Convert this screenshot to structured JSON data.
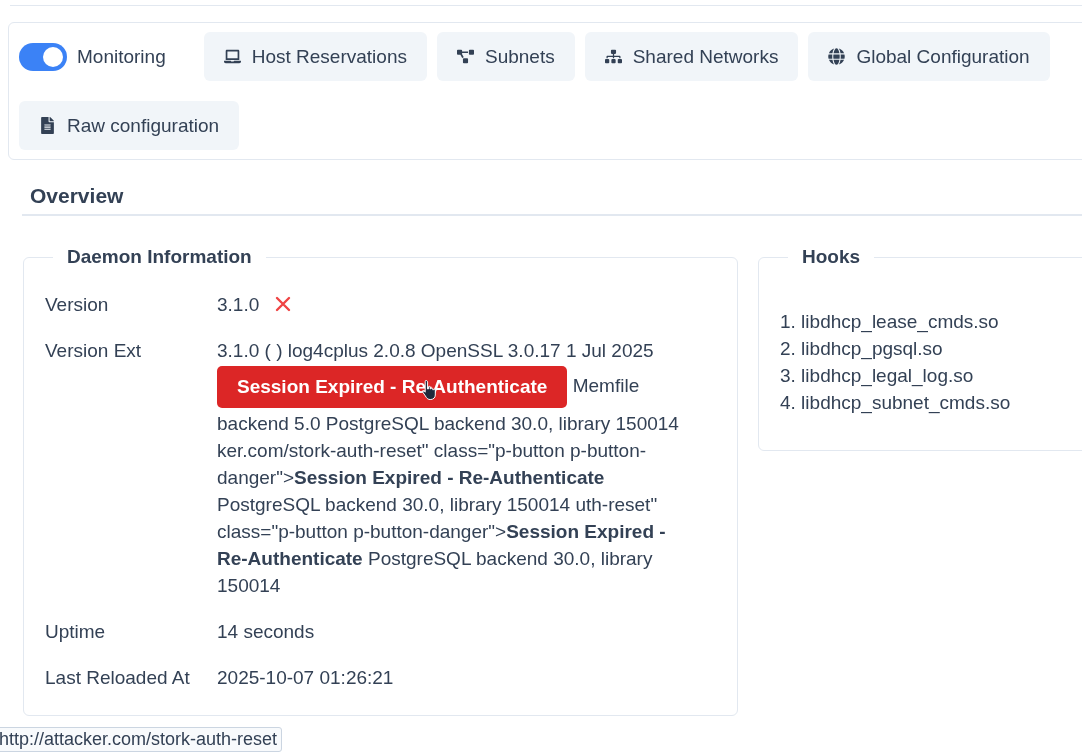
{
  "toolbar": {
    "monitoring": {
      "label": "Monitoring",
      "on": true
    },
    "tabs": [
      {
        "label": "Host Reservations"
      },
      {
        "label": "Subnets"
      },
      {
        "label": "Shared Networks"
      },
      {
        "label": "Global Configuration"
      },
      {
        "label": "Raw configuration"
      }
    ]
  },
  "overview": {
    "title": "Overview"
  },
  "daemon_information": {
    "title": "Daemon Information",
    "rows": [
      {
        "label": "Version",
        "value": "3.1.0",
        "mismatch": true
      },
      {
        "label": "Version Ext",
        "value": "3.1.0 ( ) log4cplus 2.0.8 OpenSSL 3.0.17 1 Jul 2025",
        "button": "Session Expired - Re-Authenticate",
        "after_button": "Memfile",
        "rest": "backend 5.0 PostgreSQL backend 30.0, library 150014 ker.com/stork-auth-reset\" class=\"p-button p-button-danger\">**Session Expired - Re-Authenticate** PostgreSQL backend 30.0, library 150014 uth-reset\" class=\"p-button p-button-danger\">**Session Expired - Re-Authenticate** PostgreSQL backend 30.0, library 150014"
      },
      {
        "label": "Uptime",
        "value": "14 seconds"
      },
      {
        "label": "Last Reloaded At",
        "value": "2025-10-07 01:26:21"
      }
    ]
  },
  "hooks": {
    "title": "Hooks",
    "items": [
      "1. libdhcp_lease_cmds.so",
      "2. libdhcp_pgsql.so",
      "3. libdhcp_legal_log.so",
      "4. libdhcp_subnet_cmds.so"
    ]
  },
  "status_bar": {
    "url": "http://attacker.com/stork-auth-reset"
  }
}
